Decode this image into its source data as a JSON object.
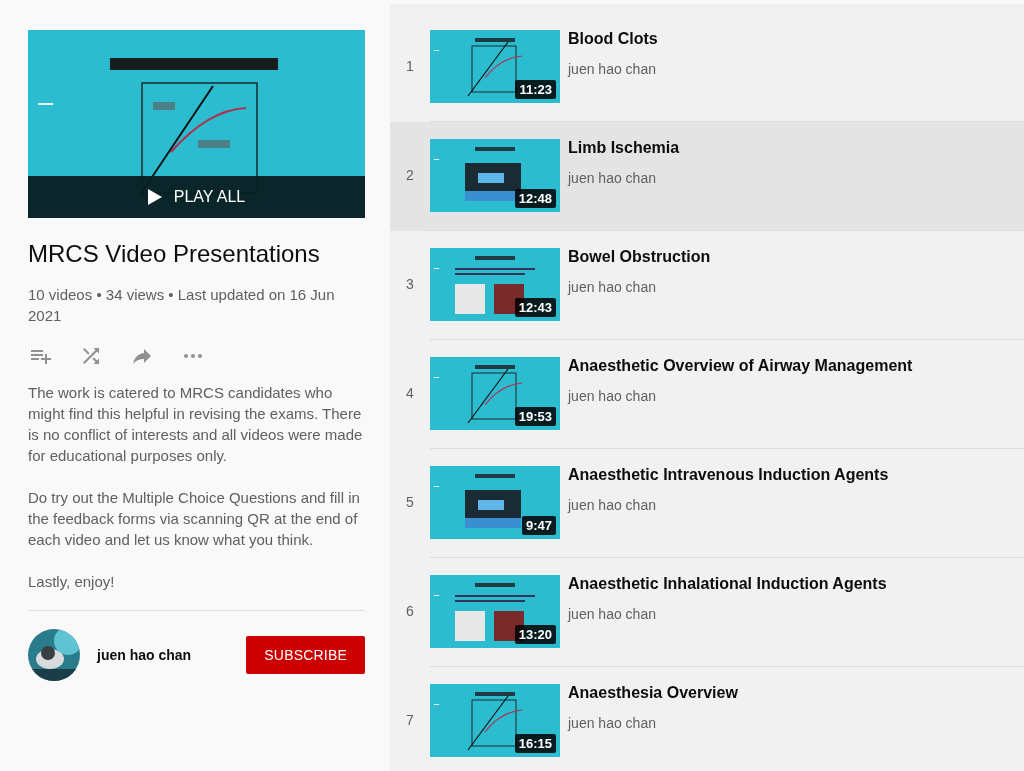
{
  "playlist": {
    "play_all": "PLAY ALL",
    "title": "MRCS Video Presentations",
    "stats": "10 videos • 34 views • Last updated on 16 Jun 2021",
    "description": [
      "The work is catered to MRCS candidates who might find this helpful in revising the exams. There is no conflict of interests and all videos were made for educational purposes only.",
      "Do try out the Multiple Choice Questions and fill in the feedback forms via scanning QR at the end of each video and let us know what you think.",
      "Lastly, enjoy!"
    ],
    "owner": {
      "name": "juen hao chan",
      "subscribe": "SUBSCRIBE"
    }
  },
  "videos": [
    {
      "index": "1",
      "title": "Blood Clots",
      "channel": "juen hao chan",
      "duration": "11:23",
      "selected": false
    },
    {
      "index": "2",
      "title": "Limb Ischemia",
      "channel": "juen hao chan",
      "duration": "12:48",
      "selected": true
    },
    {
      "index": "3",
      "title": "Bowel Obstruction",
      "channel": "juen hao chan",
      "duration": "12:43",
      "selected": false
    },
    {
      "index": "4",
      "title": "Anaesthetic Overview of Airway Management",
      "channel": "juen hao chan",
      "duration": "19:53",
      "selected": false
    },
    {
      "index": "5",
      "title": "Anaesthetic Intravenous Induction Agents",
      "channel": "juen hao chan",
      "duration": "9:47",
      "selected": false
    },
    {
      "index": "6",
      "title": "Anaesthetic Inhalational Induction Agents",
      "channel": "juen hao chan",
      "duration": "13:20",
      "selected": false
    },
    {
      "index": "7",
      "title": "Anaesthesia Overview",
      "channel": "juen hao chan",
      "duration": "16:15",
      "selected": false
    }
  ]
}
